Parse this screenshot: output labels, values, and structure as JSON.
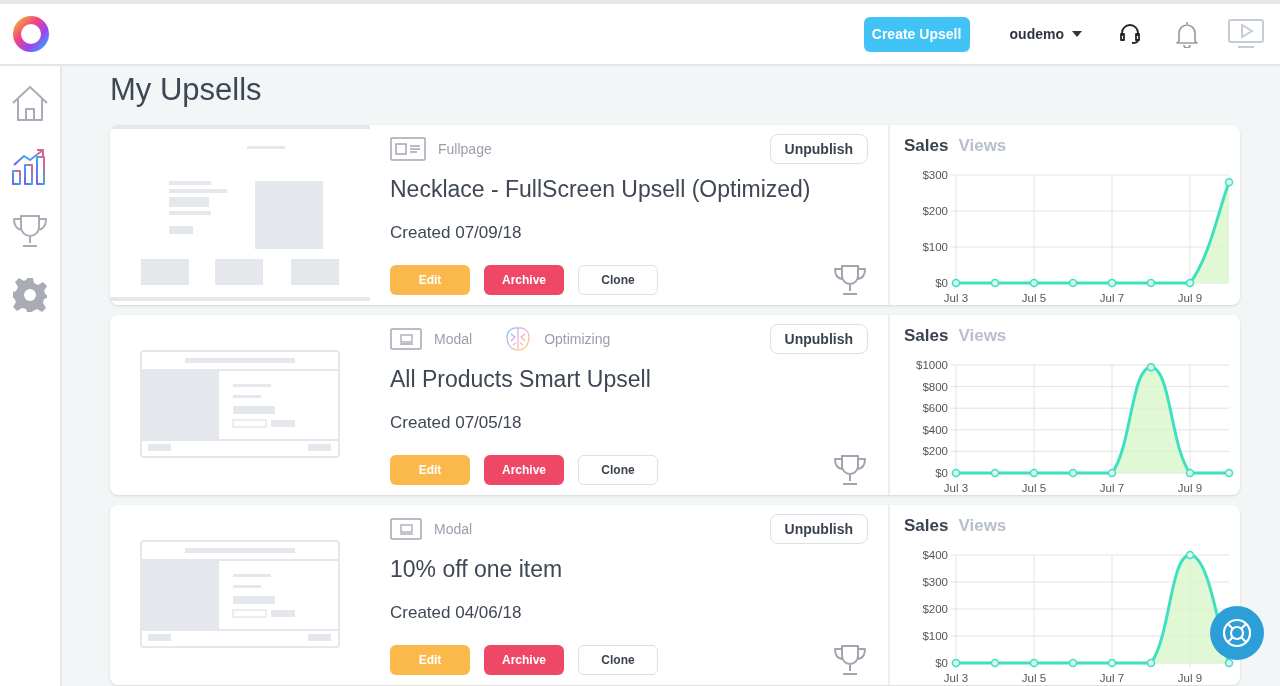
{
  "topbar": {
    "create_button": "Create Upsell",
    "user": "oudemo"
  },
  "page_title": "My Upsells",
  "sidebar": {
    "items": [
      {
        "kind": "home",
        "selected": false
      },
      {
        "kind": "analytics",
        "selected": true
      },
      {
        "kind": "trophy",
        "selected": false
      },
      {
        "kind": "settings",
        "selected": false
      }
    ]
  },
  "upsells": [
    {
      "kind": "fullpage",
      "type": "Fullpage",
      "title": "Necklace - FullScreen Upsell (Optimized)",
      "created": "Created 07/09/18",
      "buttons": {
        "edit": "Edit",
        "archive": "Archive",
        "clone": "Clone",
        "unpublish": "Unpublish"
      },
      "tabs": [
        {
          "label": "Sales",
          "selected": true
        },
        {
          "label": "Views",
          "selected": false
        }
      ],
      "chart_data": {
        "type": "area",
        "grid": true,
        "categories": [
          "Jul 3",
          null,
          "Jul 5",
          null,
          "Jul 7",
          null,
          "Jul 9",
          null
        ],
        "series": [
          {
            "color": "#3ee0c0",
            "values": [
              0,
              0,
              0,
              0,
              0,
              0,
              0,
              280
            ]
          }
        ],
        "ylim": [
          0,
          300
        ],
        "yticks": [
          {
            "value": 0,
            "label": "$0"
          },
          {
            "value": 100,
            "label": "$100"
          },
          {
            "value": 200,
            "label": "$200"
          },
          {
            "value": 300,
            "label": "$300"
          }
        ]
      }
    },
    {
      "kind": "modal",
      "type": "Modal",
      "status": "Optimizing",
      "title": "All Products Smart Upsell",
      "created": "Created 07/05/18",
      "buttons": {
        "edit": "Edit",
        "archive": "Archive",
        "clone": "Clone",
        "unpublish": "Unpublish"
      },
      "tabs": [
        {
          "label": "Sales",
          "selected": true
        },
        {
          "label": "Views",
          "selected": false
        }
      ],
      "chart_data": {
        "type": "area",
        "grid": true,
        "categories": [
          "Jul 3",
          null,
          "Jul 5",
          null,
          "Jul 7",
          null,
          "Jul 9",
          null
        ],
        "series": [
          {
            "color": "#3ee0c0",
            "values": [
              0,
              0,
              0,
              0,
              0,
              980,
              0,
              0
            ]
          }
        ],
        "ylim": [
          0,
          1000
        ],
        "yticks": [
          {
            "value": 0,
            "label": "$0"
          },
          {
            "value": 200,
            "label": "$200"
          },
          {
            "value": 400,
            "label": "$400"
          },
          {
            "value": 600,
            "label": "$600"
          },
          {
            "value": 800,
            "label": "$800"
          },
          {
            "value": 1000,
            "label": "$1000"
          }
        ]
      }
    },
    {
      "kind": "modal",
      "type": "Modal",
      "title": "10% off one item",
      "created": "Created 04/06/18",
      "buttons": {
        "edit": "Edit",
        "archive": "Archive",
        "clone": "Clone",
        "unpublish": "Unpublish"
      },
      "tabs": [
        {
          "label": "Sales",
          "selected": true
        },
        {
          "label": "Views",
          "selected": false
        }
      ],
      "chart_data": {
        "type": "area",
        "grid": true,
        "categories": [
          "Jul 3",
          null,
          "Jul 5",
          null,
          "Jul 7",
          null,
          "Jul 9",
          null
        ],
        "series": [
          {
            "color": "#3ee0c0",
            "values": [
              0,
              0,
              0,
              0,
              0,
              0,
              400,
              0
            ]
          }
        ],
        "ylim": [
          0,
          400
        ],
        "yticks": [
          {
            "value": 0,
            "label": "$0"
          },
          {
            "value": 100,
            "label": "$100"
          },
          {
            "value": 200,
            "label": "$200"
          },
          {
            "value": 300,
            "label": "$300"
          },
          {
            "value": 400,
            "label": "$400"
          }
        ]
      }
    }
  ]
}
